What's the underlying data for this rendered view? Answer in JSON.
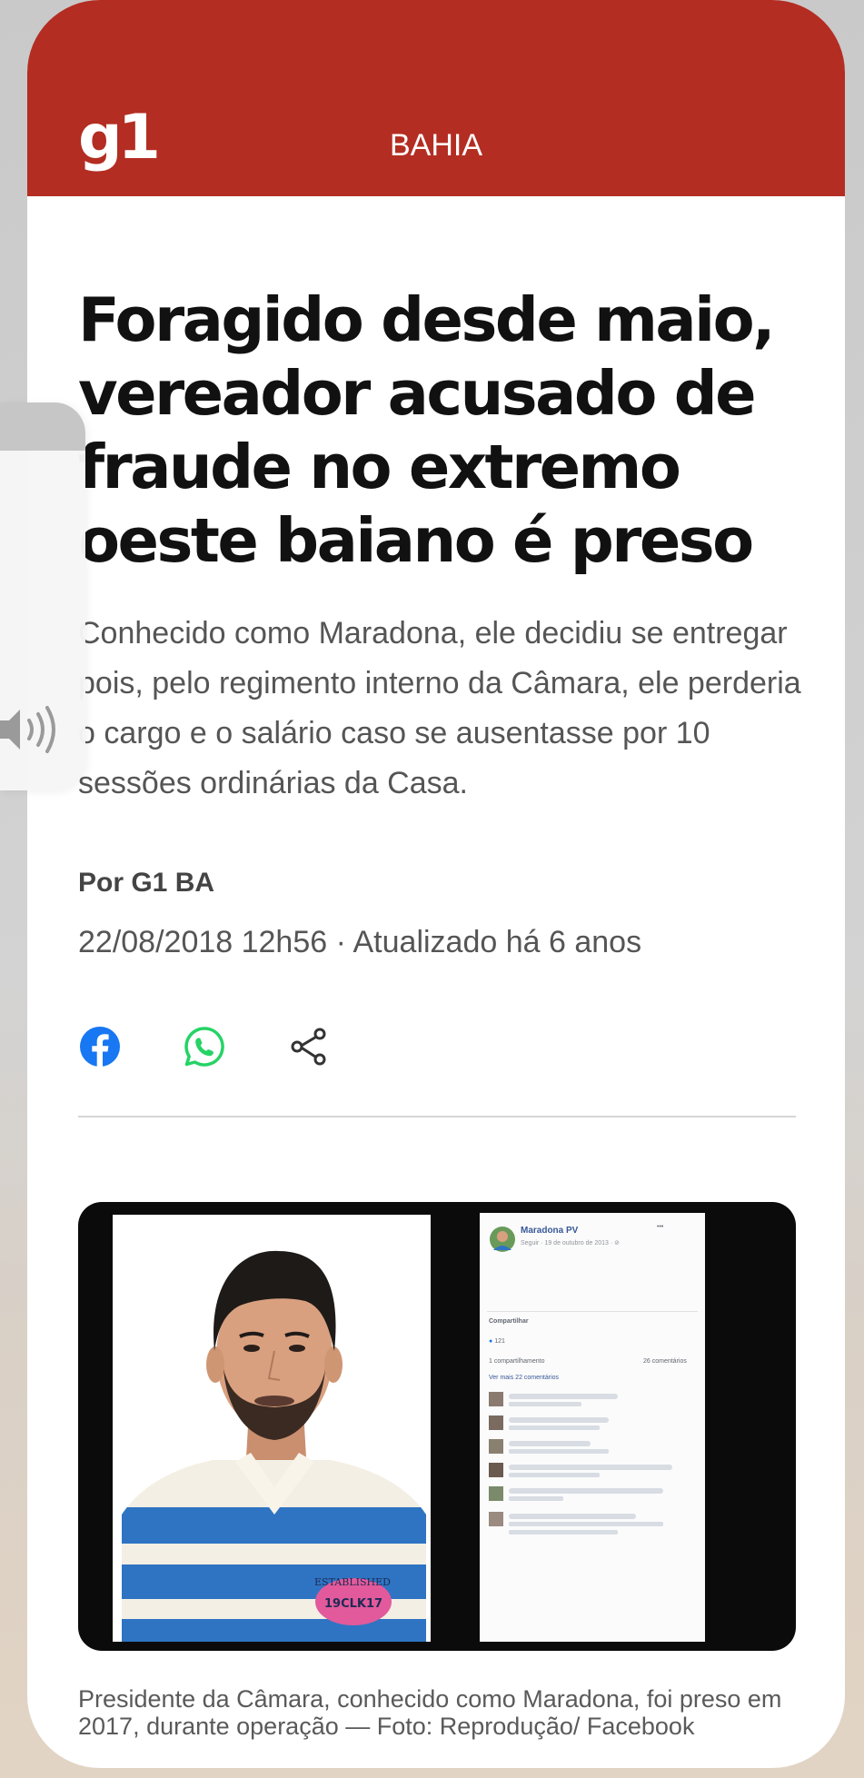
{
  "header": {
    "logo": "g1",
    "section": "BAHIA"
  },
  "article": {
    "headline": "Foragido desde maio, vereador acusado de fraude no extremo oeste baiano é preso",
    "subtitle": "Conhecido como Maradona, ele decidiu se entregar pois, pelo regimento interno da Câmara, ele perderia o cargo e o salário caso se ausentasse por 10 sessões ordinárias da Casa.",
    "byline": "Por G1 BA",
    "dateline": "22/08/2018 12h56 · Atualizado há 6 anos"
  },
  "share": {
    "icons": [
      "facebook-icon",
      "whatsapp-icon",
      "share-icon"
    ],
    "colors": {
      "facebook": "#1877f2",
      "whatsapp": "#25d366",
      "share": "#333333"
    }
  },
  "media": {
    "fb_post": {
      "name": "Maradona PV",
      "meta": "Seguir · 19 de outubro de 2013 · ⊘",
      "share_label": "Compartilhar",
      "likes": "121",
      "shares": "1 compartilhamento",
      "comments_count": "26 comentários",
      "more_comments": "Ver mais 22 comentários"
    },
    "shirt_text": "ESTABLISHED",
    "badge_text": "19CLK17",
    "caption": "Presidente da Câmara, conhecido como Maradona, foi preso em 2017, durante operação — Foto: Reprodução/ Facebook"
  },
  "colors": {
    "brand": "#b32d22",
    "headline": "#111111",
    "text": "#555555"
  }
}
